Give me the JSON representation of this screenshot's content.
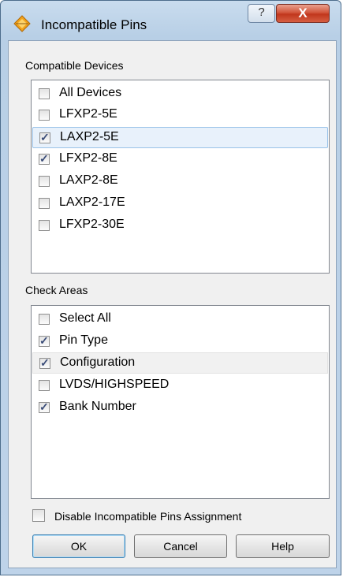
{
  "window": {
    "title": "Incompatible Pins"
  },
  "titlebar": {
    "help_glyph": "?",
    "close_glyph": "X"
  },
  "devices": {
    "label": "Compatible Devices",
    "items": [
      {
        "label": "All Devices",
        "checked": false
      },
      {
        "label": "LFXP2-5E",
        "checked": false
      },
      {
        "label": "LAXP2-5E",
        "checked": true,
        "selected": true
      },
      {
        "label": "LFXP2-8E",
        "checked": true
      },
      {
        "label": "LAXP2-8E",
        "checked": false
      },
      {
        "label": "LAXP2-17E",
        "checked": false
      },
      {
        "label": "LFXP2-30E",
        "checked": false
      }
    ]
  },
  "areas": {
    "label": "Check Areas",
    "items": [
      {
        "label": "Select All",
        "checked": false
      },
      {
        "label": "Pin Type",
        "checked": true
      },
      {
        "label": "Configuration",
        "checked": true,
        "hover": true
      },
      {
        "label": "LVDS/HIGHSPEED",
        "checked": false
      },
      {
        "label": "Bank Number",
        "checked": true
      }
    ]
  },
  "footer": {
    "disable_label": "Disable Incompatible Pins Assignment",
    "disable_checked": false,
    "ok_label": "OK",
    "cancel_label": "Cancel",
    "help_label": "Help"
  },
  "colors": {
    "checkmark": "#3a4c78",
    "selection": "#e8f1fb",
    "close_button": "#c1361c"
  }
}
